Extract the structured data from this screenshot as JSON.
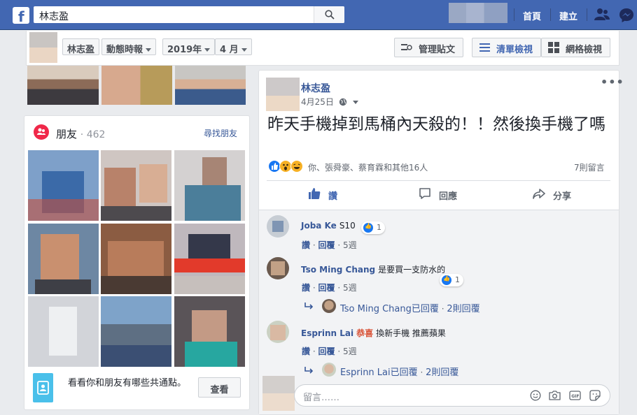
{
  "topbar": {
    "logo": "f",
    "search_value": "林志盈",
    "nav": [
      "首頁",
      "建立"
    ],
    "icons": [
      "search-icon",
      "friends-icon",
      "messenger-icon"
    ]
  },
  "header": {
    "buttons": [
      {
        "label": "林志盈",
        "dropdown": false
      },
      {
        "label": "動態時報",
        "dropdown": true
      },
      {
        "label": "2019年",
        "dropdown": true
      },
      {
        "label": "4 月",
        "dropdown": true
      }
    ],
    "manage": "管理貼文",
    "list_view": "清單檢視",
    "grid_view": "網格檢視"
  },
  "friends": {
    "title": "朋友",
    "count": "· 462",
    "find": "尋找朋友",
    "prompt": "看看你和朋友有哪些共通點。",
    "see_button": "查看"
  },
  "post": {
    "author": "林志盈",
    "date": "4月25日",
    "text": "昨天手機掉到馬桶內天殺的！！然後換手機了嗎",
    "reactions_text": "你、張舜豪、蔡育霖和其他16人",
    "comment_count": "7則留言",
    "actions": {
      "like": "讚",
      "comment": "回應",
      "share": "分享"
    }
  },
  "comments": [
    {
      "name": "Joba Ke",
      "text": "S10",
      "highlight": "",
      "likes": "1",
      "when": "5週",
      "reply": ""
    },
    {
      "name": "Tso Ming Chang",
      "text": "是要買一支防水的",
      "highlight": "",
      "likes": "1",
      "when": "5週",
      "reply": {
        "name": "Tso Ming Chang已回覆",
        "sep": " · ",
        "count": "2則回覆"
      }
    },
    {
      "name": "Esprinn Lai",
      "highlight": "恭喜",
      "text": "換新手機 推薦蘋果",
      "likes": "",
      "when": "5週",
      "reply": {
        "name": "Esprinn Lai已回覆",
        "sep": " · ",
        "count": "2則回覆"
      }
    }
  ],
  "comment_actions": {
    "like": "讚",
    "reply": "回覆",
    "sep": "·"
  },
  "comment_box": {
    "placeholder": "留言……"
  },
  "colors": {
    "brand": "#4267b2",
    "link": "#385898",
    "like_blue": "#1877f2",
    "friends_red": "#f02849"
  }
}
